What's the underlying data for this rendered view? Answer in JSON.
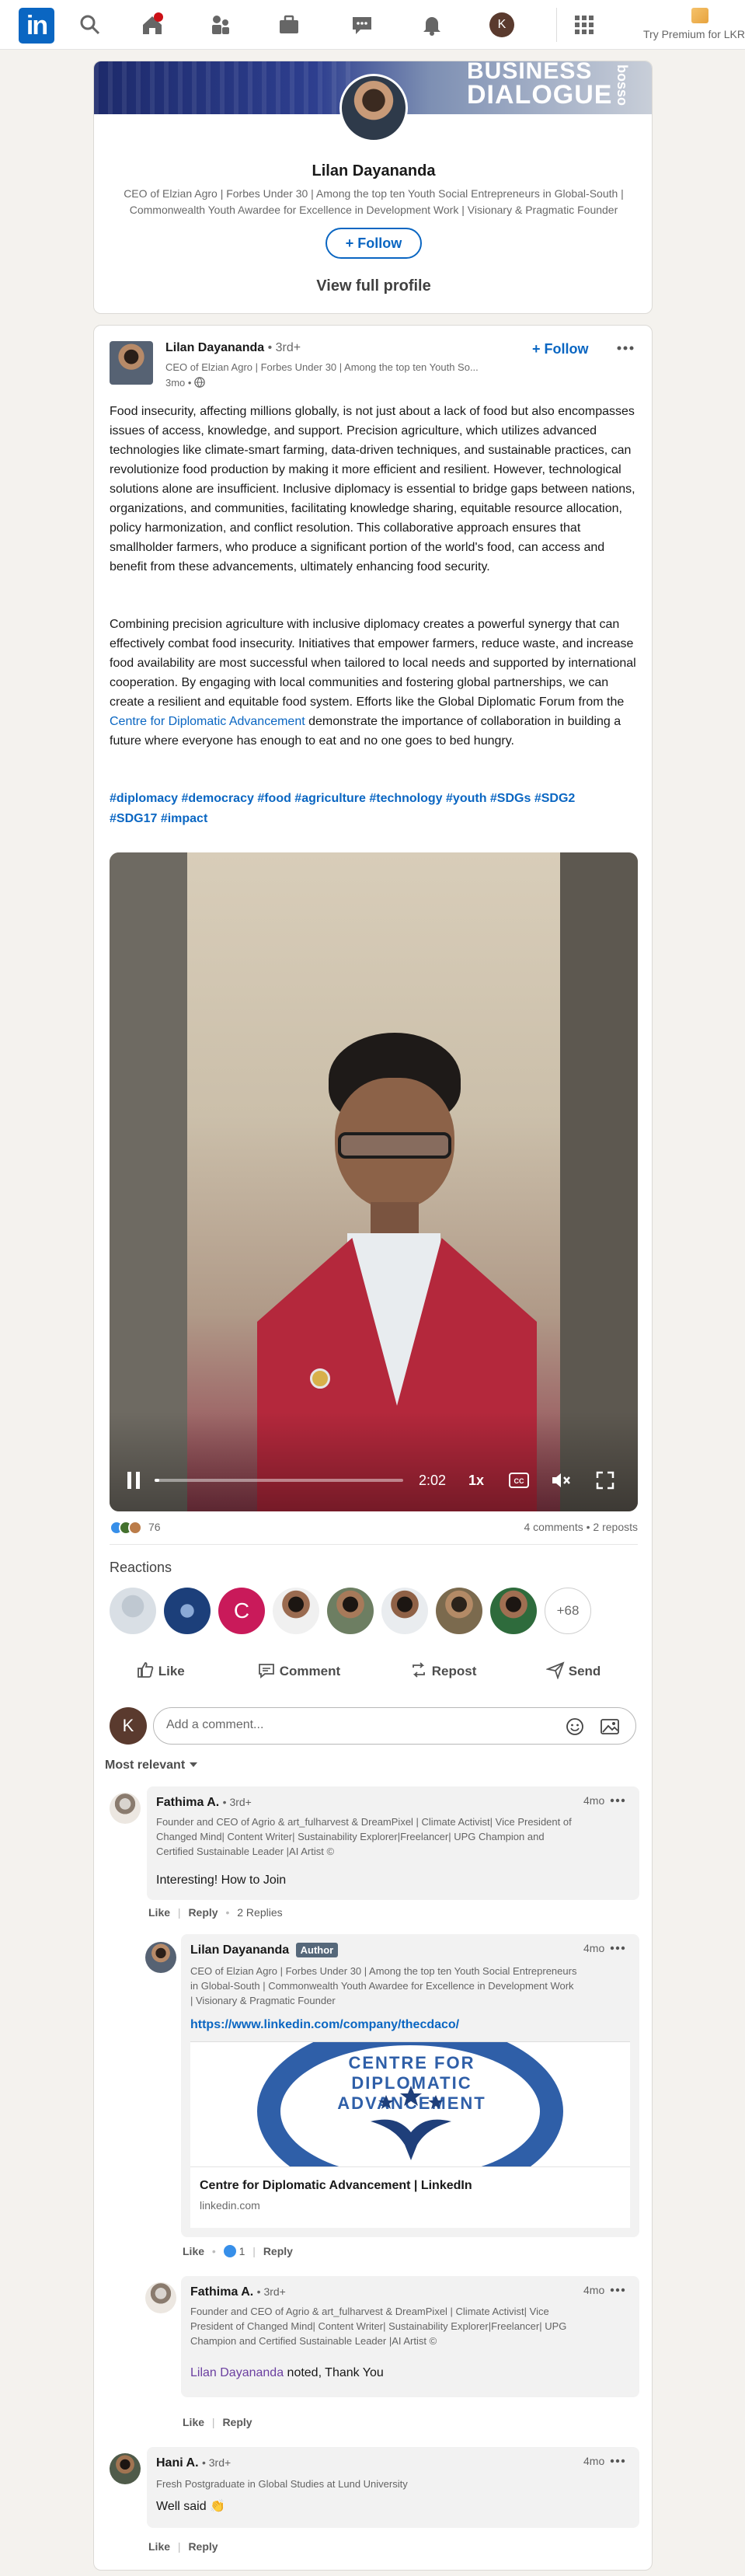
{
  "nav": {
    "logo": "in",
    "premium_text": "Try Premium for LKR",
    "items": [
      "search-icon",
      "home-icon",
      "my-network-icon",
      "jobs-icon",
      "messaging-icon",
      "notifications-icon",
      "me-avatar",
      "grid-icon"
    ],
    "me_initial": "K"
  },
  "profile_card": {
    "banner_text_1": "BUSINESS",
    "banner_text_2": "DIALOGUE",
    "banner_side": "bosso",
    "name": "Lilan Dayananda",
    "headline": "CEO of Elzian Agro | Forbes Under 30 | Among the top ten Youth Social Entrepreneurs in Global-South | Commonwealth Youth Awardee for Excellence in Development Work | Visionary & Pragmatic Founder",
    "follow_label": "+ Follow",
    "view_profile_label": "View full profile"
  },
  "post": {
    "author": "Lilan Dayananda",
    "degree": "• 3rd+",
    "headline": "CEO of Elzian Agro | Forbes Under 30 | Among the top ten Youth So...",
    "time": "3mo •",
    "follow_label": "+ Follow",
    "para1": "Food insecurity, affecting millions globally, is not just about a lack of food but also encompasses issues of access, knowledge, and support. Precision agriculture, which utilizes advanced technologies like climate-smart farming, data-driven techniques, and sustainable practices, can revolutionize food production by making it more efficient and resilient. However, technological solutions alone are insufficient. Inclusive diplomacy is essential to bridge gaps between nations, organizations, and communities, facilitating knowledge sharing, equitable resource allocation, policy harmonization, and conflict resolution. This collaborative approach ensures that smallholder farmers, who produce a significant portion of the world's food, can access and benefit from these advancements, ultimately enhancing food security.",
    "para2_a": "Combining precision agriculture with inclusive diplomacy creates a powerful synergy that can effectively combat food insecurity. Initiatives that empower farmers, reduce waste, and increase food availability are most successful when tailored to local needs and supported by international cooperation. By engaging with local communities and fostering global partnerships, we can create a resilient and equitable food system. Efforts like the Global Diplomatic Forum from the ",
    "para2_link": "Centre for Diplomatic Advancement",
    "para2_b": " demonstrate the importance of collaboration in building a future where everyone has enough to eat and no one goes to bed hungry.",
    "hashtags_1": "#diplomacy #democracy #food #agriculture #technology #youth #SDGs #SDG2",
    "hashtags_2": "#SDG17 #impact",
    "video": {
      "time": "2:02",
      "speed": "1x",
      "progress": 0.02
    },
    "reaction_count": "76",
    "comments_reposts": "4 comments • 2 reposts",
    "reactions_title": "Reactions",
    "reactors_more": "+68",
    "reactor_initial": "C",
    "actions": {
      "like": "Like",
      "comment": "Comment",
      "repost": "Repost",
      "send": "Send"
    },
    "add_comment_placeholder": "Add a comment...",
    "sort_label": "Most relevant"
  },
  "comments": [
    {
      "name": "Fathima A.",
      "degree": "• 3rd+",
      "headline": "Founder and CEO of Agrio & art_fulharvest & DreamPixel | Climate Activist| Vice President of Changed Mind| Content Writer| Sustainability Explorer|Freelancer| UPG Champion and Certified Sustainable Leader |AI Artist ©",
      "time": "4mo",
      "text": "Interesting! How to Join",
      "like": "Like",
      "reply": "Reply",
      "replies": "2 Replies"
    },
    {
      "name": "Lilan Dayananda",
      "badge": "Author",
      "headline": "CEO of Elzian Agro | Forbes Under 30 | Among the top ten Youth Social Entrepreneurs in Global-South | Commonwealth Youth Awardee for Excellence in Development Work | Visionary & Pragmatic Founder",
      "time": "4mo",
      "link": "https://www.linkedin.com/company/thecdaco/",
      "preview_title": "Centre for Diplomatic Advancement | LinkedIn",
      "preview_domain": "linkedin.com",
      "preview_logo_text": "CENTRE FOR DIPLOMATIC ADVANCEMENT",
      "like": "Like",
      "like_count": "1",
      "reply": "Reply"
    },
    {
      "name": "Fathima A.",
      "degree": "• 3rd+",
      "headline": "Founder and CEO of Agrio & art_fulharvest & DreamPixel | Climate Activist| Vice President of Changed Mind| Content Writer| Sustainability Explorer|Freelancer| UPG Champion and Certified Sustainable Leader |AI Artist ©",
      "time": "4mo",
      "mention": "Lilan Dayananda",
      "text": " noted, Thank You",
      "like": "Like",
      "reply": "Reply"
    },
    {
      "name": "Hani A.",
      "degree": "• 3rd+",
      "headline": "Fresh Postgraduate in Global Studies at Lund University",
      "time": "4mo",
      "text": "Well said 👏",
      "like": "Like",
      "reply": "Reply"
    }
  ]
}
